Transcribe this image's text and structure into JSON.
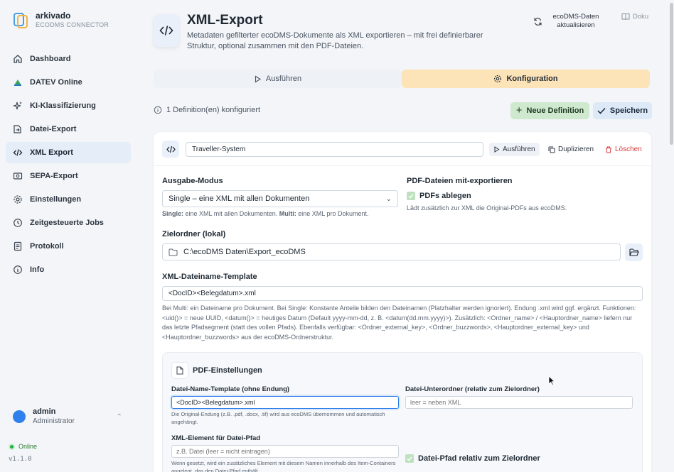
{
  "app": {
    "name": "arkivado",
    "subtitle": "ECODMS CONNECTOR"
  },
  "sidebar": {
    "items": [
      {
        "label": "Dashboard",
        "icon": "home-icon"
      },
      {
        "label": "DATEV Online",
        "icon": "datev-icon"
      },
      {
        "label": "KI-Klassifizierung",
        "icon": "sparkle-icon"
      },
      {
        "label": "Datei-Export",
        "icon": "file-export-icon"
      },
      {
        "label": "XML Export",
        "icon": "code-icon"
      },
      {
        "label": "SEPA-Export",
        "icon": "bank-icon"
      },
      {
        "label": "Einstellungen",
        "icon": "gear-icon"
      },
      {
        "label": "Zeitgesteuerte Jobs",
        "icon": "clock-icon"
      },
      {
        "label": "Protokoll",
        "icon": "log-icon"
      },
      {
        "label": "Info",
        "icon": "info-icon"
      }
    ],
    "active_index": 4
  },
  "user": {
    "name": "admin",
    "role": "Administrator"
  },
  "status": {
    "label": "Online",
    "color": "#22b04a"
  },
  "version": "v1.1.0",
  "header": {
    "title": "XML-Export",
    "subtitle": "Metadaten gefilterter ecoDMS-Dokumente als XML exportieren – mit frei definierbarer Struktur, optional zusammen mit den PDF-Dateien.",
    "refresh_label": "ecoDMS-Daten aktualisieren",
    "doku_label": "Doku"
  },
  "tabs": {
    "run": "Ausführen",
    "config": "Konfiguration"
  },
  "toolbar": {
    "definitions_info": "1 Definition(en) konfiguriert",
    "new_definition": "Neue Definition",
    "save": "Speichern"
  },
  "definition": {
    "name": "Traveller-System",
    "run_label": "Ausführen",
    "duplicate_label": "Duplizieren",
    "delete_label": "Löschen"
  },
  "form": {
    "output_mode_label": "Ausgabe-Modus",
    "output_mode_value": "Single – eine XML mit allen Dokumenten",
    "output_mode_hint_single": "Single:",
    "output_mode_hint_single_text": " eine XML mit allen Dokumenten. ",
    "output_mode_hint_multi": "Multi:",
    "output_mode_hint_multi_text": " eine XML pro Dokument.",
    "pdf_export_label": "PDF-Dateien mit-exportieren",
    "pdf_checkbox_label": "PDFs ablegen",
    "pdf_hint": "Lädt zusätzlich zur XML die Original-PDFs aus ecoDMS.",
    "target_folder_label": "Zielordner (lokal)",
    "target_folder_value": "C:\\ecoDMS Daten\\Export_ecoDMS",
    "filename_template_label": "XML-Dateiname-Template",
    "filename_template_value": "<DocID><Belegdatum>.xml",
    "filename_hint": "Bei Multi: ein Dateiname pro Dokument. Bei Single: Konstante Anteile bilden den Dateinamen (Platzhalter werden ignoriert). Endung .xml wird ggf. ergänzt. Funktionen: <uid()> = neue UUID, <datum()> = heutiges Datum (Default yyyy-mm-dd, z. B. <datum(dd.mm.yyyy)>). Zusätzlich: <Ordner_name> / <Hauptordner_name> liefern nur das letzte Pfadsegment (statt des vollen Pfads). Ebenfalls verfügbar: <Ordner_external_key>, <Ordner_buzzwords>, <Hauptordner_external_key> und <Hauptordner_buzzwords> aus der ecoDMS-Ordnerstruktur."
  },
  "pdf_settings": {
    "title": "PDF-Einstellungen",
    "name_template_label": "Datei-Name-Template (ohne Endung)",
    "name_template_value": "<DocID><Belegdatum>.xml",
    "name_template_hint": "Die Original-Endung (z.B. .pdf, .docx, .tif) wird aus ecoDMS übernommen und automatisch angehängt.",
    "subfolder_label": "Datei-Unterordner (relativ zum Zielordner)",
    "subfolder_placeholder": "leer = neben XML",
    "xml_element_label": "XML-Element für Datei-Pfad",
    "xml_element_placeholder": "z.B. Datei (leer = nicht eintragen)",
    "xml_element_hint": "Wenn gesetzt, wird ein zusätzliches Element mit diesem Namen innerhalb des Item-Containers angelegt, das den Datei-Pfad enthält.",
    "relative_path_label": "Datei-Pfad relativ zum Zielordner"
  }
}
